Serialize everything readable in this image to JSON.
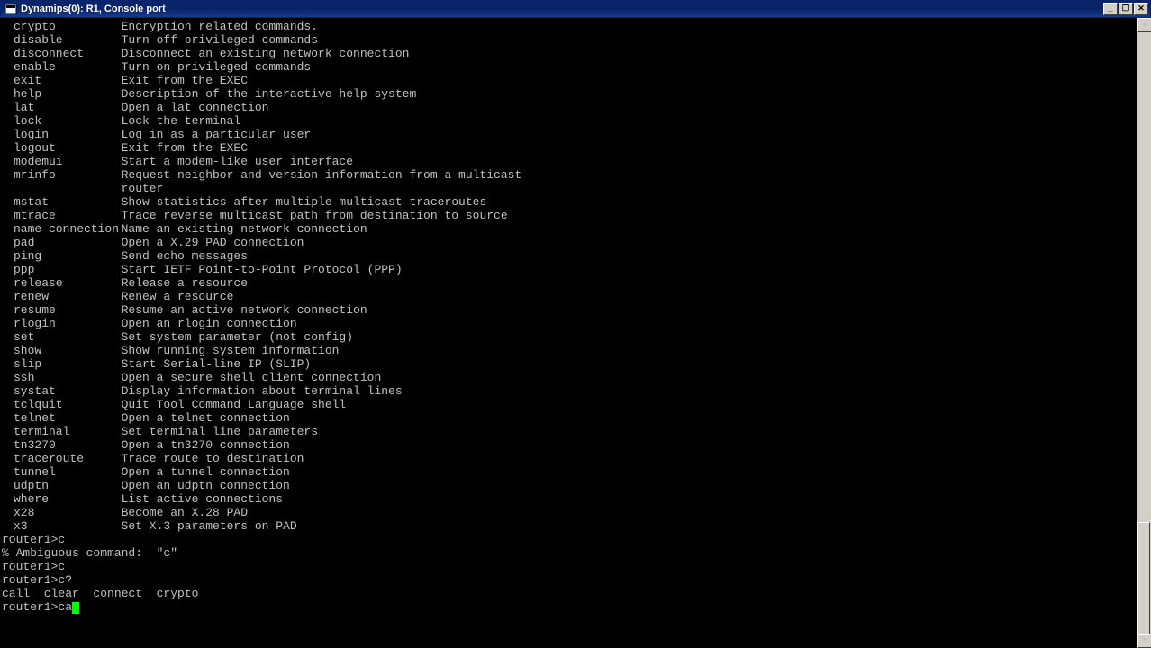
{
  "window": {
    "title": "Dynamips(0): R1, Console port"
  },
  "help": [
    {
      "cmd": "crypto",
      "desc": "Encryption related commands."
    },
    {
      "cmd": "disable",
      "desc": "Turn off privileged commands"
    },
    {
      "cmd": "disconnect",
      "desc": "Disconnect an existing network connection"
    },
    {
      "cmd": "enable",
      "desc": "Turn on privileged commands"
    },
    {
      "cmd": "exit",
      "desc": "Exit from the EXEC"
    },
    {
      "cmd": "help",
      "desc": "Description of the interactive help system"
    },
    {
      "cmd": "lat",
      "desc": "Open a lat connection"
    },
    {
      "cmd": "lock",
      "desc": "Lock the terminal"
    },
    {
      "cmd": "login",
      "desc": "Log in as a particular user"
    },
    {
      "cmd": "logout",
      "desc": "Exit from the EXEC"
    },
    {
      "cmd": "modemui",
      "desc": "Start a modem-like user interface"
    },
    {
      "cmd": "mrinfo",
      "desc": "Request neighbor and version information from a multicast"
    },
    {
      "cmd": "",
      "desc": "router"
    },
    {
      "cmd": "mstat",
      "desc": "Show statistics after multiple multicast traceroutes"
    },
    {
      "cmd": "mtrace",
      "desc": "Trace reverse multicast path from destination to source"
    },
    {
      "cmd": "name-connection",
      "desc": "Name an existing network connection"
    },
    {
      "cmd": "pad",
      "desc": "Open a X.29 PAD connection"
    },
    {
      "cmd": "ping",
      "desc": "Send echo messages"
    },
    {
      "cmd": "ppp",
      "desc": "Start IETF Point-to-Point Protocol (PPP)"
    },
    {
      "cmd": "release",
      "desc": "Release a resource"
    },
    {
      "cmd": "renew",
      "desc": "Renew a resource"
    },
    {
      "cmd": "resume",
      "desc": "Resume an active network connection"
    },
    {
      "cmd": "rlogin",
      "desc": "Open an rlogin connection"
    },
    {
      "cmd": "set",
      "desc": "Set system parameter (not config)"
    },
    {
      "cmd": "show",
      "desc": "Show running system information"
    },
    {
      "cmd": "slip",
      "desc": "Start Serial-line IP (SLIP)"
    },
    {
      "cmd": "ssh",
      "desc": "Open a secure shell client connection"
    },
    {
      "cmd": "systat",
      "desc": "Display information about terminal lines"
    },
    {
      "cmd": "tclquit",
      "desc": "Quit Tool Command Language shell"
    },
    {
      "cmd": "telnet",
      "desc": "Open a telnet connection"
    },
    {
      "cmd": "terminal",
      "desc": "Set terminal line parameters"
    },
    {
      "cmd": "tn3270",
      "desc": "Open a tn3270 connection"
    },
    {
      "cmd": "traceroute",
      "desc": "Trace route to destination"
    },
    {
      "cmd": "tunnel",
      "desc": "Open a tunnel connection"
    },
    {
      "cmd": "udptn",
      "desc": "Open an udptn connection"
    },
    {
      "cmd": "where",
      "desc": "List active connections"
    },
    {
      "cmd": "x28",
      "desc": "Become an X.28 PAD"
    },
    {
      "cmd": "x3",
      "desc": "Set X.3 parameters on PAD"
    }
  ],
  "session": {
    "blank1": "",
    "line1": "router1>c",
    "line2": "% Ambiguous command:  \"c\"",
    "line3": "router1>c",
    "line4": "router1>c?",
    "line5": "call  clear  connect  crypto",
    "blank2": "",
    "prompt": "router1>",
    "typed": "ca"
  }
}
